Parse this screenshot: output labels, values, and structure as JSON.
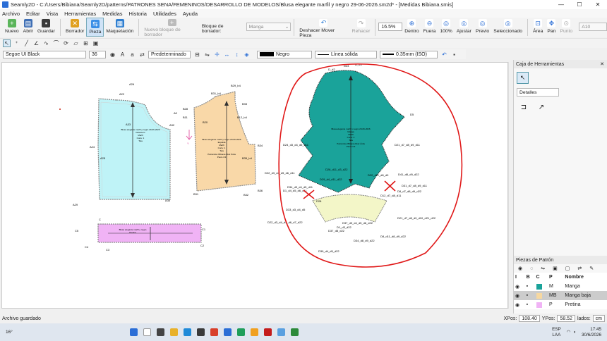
{
  "window": {
    "title": "Seamly2D - C:/Users/Bibiana/Seamly2D/patterns/PATRONES SENA/FEMENINOS/DESARROLLO DE MODELOS/Blusa elegante marfil y negro 29-06-2026.sm2d* - [Medidas Bibiana.smis]",
    "minimize": "—",
    "maximize": "☐",
    "close": "✕"
  },
  "menu": [
    "Archivo",
    "Editar",
    "Vista",
    "Herramientas",
    "Medidas",
    "Historia",
    "Utilidades",
    "Ayuda"
  ],
  "toolbar": {
    "nuevo": "Nuevo",
    "abrir": "Abrir",
    "guardar": "Guardar",
    "borrador": "Borrador",
    "pieza": "Pieza",
    "maquetacion": "Maquetación",
    "nuevo_bloque": "Nuevo bloque de borrador",
    "bloque_label": "Bloque de borrador:",
    "bloque_value": "Manga",
    "deshacer": "Deshacer Mover Pieza",
    "rehacer": "Rehacer",
    "zoom": "16.5%",
    "dentro": "Dentro",
    "fuera": "Fuera",
    "p100": "100%",
    "ajustar": "Ajustar",
    "previo": "Previo",
    "seleccionado": "Seleccionado",
    "area": "Área",
    "pan": "Pan",
    "punto": "Punto",
    "paper": "A10"
  },
  "props": {
    "font": "Segoe UI Black",
    "size": "36",
    "mode": "Predeterminado",
    "color": "Negro",
    "line_type": "Línea sólida",
    "line_width": "0.35mm (ISO)"
  },
  "dock": {
    "title": "Caja de Herramientas",
    "details": "Detalles",
    "close": "✕"
  },
  "pieces_panel": {
    "title": "Piezas de Patrón",
    "headers": [
      "I",
      "B",
      "C",
      "P",
      "Nombre"
    ],
    "rows": [
      {
        "c": "M",
        "name": "Manga",
        "color": "#1aa39a"
      },
      {
        "c": "MB",
        "name": "Manga baja",
        "color": "#f7e7b4"
      },
      {
        "c": "P",
        "name": "Pretina",
        "color": "#f0b3f5"
      }
    ]
  },
  "status": {
    "left": "Archivo guardado",
    "xpos_label": "XPos:",
    "xpos": "108.40",
    "ypos_label": "YPos:",
    "ypos": "58.52",
    "unit_label": "lados:",
    "unit": "cm"
  },
  "taskbar": {
    "temp": "16°",
    "lang": "ESP",
    "lang2": "LAA",
    "time": "17:45",
    "date": "30/6/2026"
  },
  "canvas": {
    "front": {
      "pts": [
        "A26",
        "A22",
        "A0",
        "A32",
        "A24",
        "A25",
        "A29",
        "A30",
        "A33"
      ],
      "info": [
        "Blusa elegante marfil y negro 29-06-2026",
        "Delantero",
        "Marfil",
        "Corte: 1",
        "Tela"
      ]
    },
    "back": {
      "pts": [
        "B31_b4",
        "B29_b4",
        "B28",
        "B11",
        "B12_b4",
        "B20",
        "B33",
        "B34",
        "B31",
        "B32",
        "B36",
        "B35_b4"
      ],
      "info": [
        "Blusa elegante marfil y negro 29-06-2026",
        "Espalda",
        "Marfil",
        "Corte: 1",
        "Tela",
        "Patronista: Bibiana Díaz Ávila",
        "Pieza 1/3"
      ]
    },
    "sleeve": {
      "pts": [
        "D_d2",
        "D23",
        "D_d3",
        "D5",
        "D24_d3_d4_d5_d11",
        "D21_d7_d8_d9_d11",
        "D22_d3_d4_d5_d6_d11",
        "D26_d11_d3_d22",
        "D20_d11_d8_d9",
        "D41_d8_d9_d22",
        "D29_d4_d11_d22",
        "D31_d7_d8_d9_d11",
        "D34_d3_d4_d5_d11",
        "D1_d4_d5_d6_d11",
        "D12_d7_d8_d11",
        "D8_d7_d8_d9_d22"
      ],
      "info": [
        "Blusa elegante marfil y negro 29-06-2026",
        "Manga",
        "Marfil",
        "Corte: 2",
        "Tela",
        "Patronista: Bibiana Díaz Ávila",
        "Pieza 1/3"
      ]
    },
    "sleeve_low": {
      "pts": [
        "D28",
        "D33_d3_d4_d5",
        "D22_d3_d4_d5_d6_d7_d22",
        "D21_d7_d8_d9_d10_d21_d22",
        "D37_d3_d4_d5_d6_d22",
        "D37_d8_d22",
        "D1_d3_d22",
        "D8_d11_d8_d9_d22",
        "D34_d8_d9_d22",
        "D39_d4_d5_d22"
      ]
    },
    "waist": {
      "pts": [
        "C",
        "C1",
        "C2",
        "C3",
        "C4",
        "C5"
      ],
      "info": [
        "Blusa elegante marfil y negro",
        "Pretina"
      ]
    }
  }
}
